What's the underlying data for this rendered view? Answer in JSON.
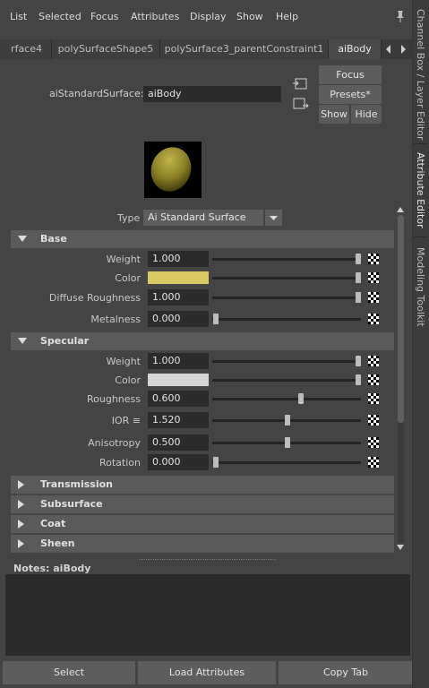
{
  "menu": [
    "List",
    "Selected",
    "Focus",
    "Attributes",
    "Display",
    "Show",
    "Help"
  ],
  "tabs": [
    "rface4",
    "polySurfaceShape5",
    "polySurface3_parentConstraint1",
    "aiBody"
  ],
  "node": {
    "type_label": "aiStandardSurface:",
    "name": "aiBody",
    "buttons": {
      "focus": "Focus",
      "presets": "Presets*",
      "show": "Show",
      "hide": "Hide"
    }
  },
  "swatch": {
    "color": "#8a7f26"
  },
  "type": {
    "label": "Type",
    "value": "Ai Standard Surface"
  },
  "sections": {
    "base": {
      "title": "Base",
      "rows": [
        {
          "label": "Weight",
          "value": "1.000",
          "slider": 1.0
        },
        {
          "label": "Color",
          "color": "#d9c962",
          "slider": 1.0
        },
        {
          "label": "Diffuse Roughness",
          "value": "1.000",
          "slider": 1.0
        },
        {
          "label": "Metalness",
          "value": "0.000",
          "slider": 0.0
        }
      ]
    },
    "specular": {
      "title": "Specular",
      "rows": [
        {
          "label": "Weight",
          "value": "1.000",
          "slider": 1.0
        },
        {
          "label": "Color",
          "color": "#d6d6d6",
          "slider": 1.0
        },
        {
          "label": "Roughness",
          "value": "0.600",
          "slider": 0.6
        },
        {
          "label": "IOR ≡",
          "value": "1.520",
          "slider": 0.5
        },
        {
          "label": "Anisotropy",
          "value": "0.500",
          "slider": 0.5
        },
        {
          "label": "Rotation",
          "value": "0.000",
          "slider": 0.0
        }
      ]
    },
    "collapsed": [
      "Transmission",
      "Subsurface",
      "Coat",
      "Sheen"
    ]
  },
  "notes": {
    "label": "Notes:  aiBody"
  },
  "bottom_buttons": {
    "select": "Select",
    "load": "Load Attributes",
    "copy": "Copy Tab"
  },
  "side_tabs": [
    "Channel Box / Layer Editor",
    "Attribute Editor",
    "Modeling Toolkit"
  ]
}
